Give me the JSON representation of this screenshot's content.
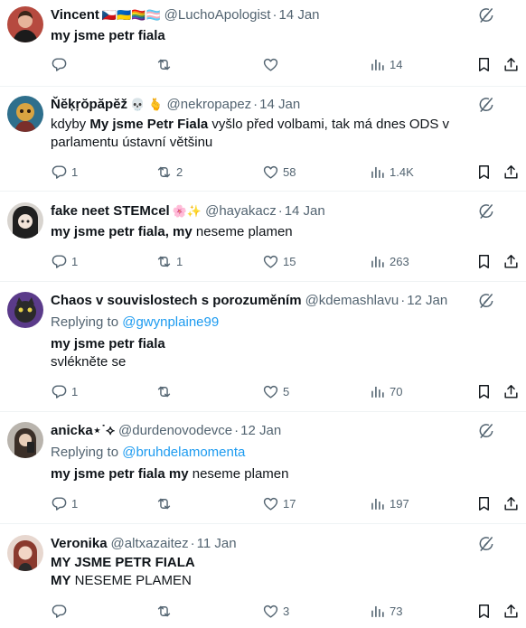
{
  "tweets": [
    {
      "name": "Vincent",
      "badges": "🇨🇿🇺🇦🏳️‍🌈🏳️‍⚧️",
      "handle": "@LuchoApologist",
      "date": "14 Jan",
      "reply_to": null,
      "text_bold": "my jsme petr fiala",
      "text_plain": "",
      "counts": {
        "replies": "",
        "retweets": "",
        "likes": "",
        "views": "14"
      },
      "avatar_color": "#7a3b35"
    },
    {
      "name": "Ňĕķŗŏpăpĕž",
      "badges": "💀 🫰",
      "handle": "@nekropapez",
      "date": "14 Jan",
      "reply_to": null,
      "text_prefix": "kdyby ",
      "text_bold": "My jsme Petr Fiala",
      "text_plain": " vyšlo před volbami, tak má dnes ODS v parlamentu ústavní většinu",
      "counts": {
        "replies": "1",
        "retweets": "2",
        "likes": "58",
        "views": "1.4K"
      },
      "avatar_color": "#2f6f8c"
    },
    {
      "name": "fake neet STEMcel",
      "badges": "🌸✨",
      "handle": "@hayakacz",
      "date": "14 Jan",
      "reply_to": null,
      "text_bold": "my jsme petr fiala, my",
      "text_plain": " neseme plamen",
      "counts": {
        "replies": "1",
        "retweets": "1",
        "likes": "15",
        "views": "263"
      },
      "avatar_color": "#3a3a3a"
    },
    {
      "name": "Chaos v souvislostech s porozuměním",
      "badges": "",
      "handle": "@kdemashlavu",
      "date": "12 Jan",
      "reply_to": {
        "label": "Replying to",
        "mention": "@gwynplaine99"
      },
      "text_bold": "my jsme petr fiala",
      "text_line2": "svlékněte se",
      "counts": {
        "replies": "1",
        "retweets": "",
        "likes": "5",
        "views": "70"
      },
      "avatar_color": "#5b3b8a"
    },
    {
      "name": "anicka⋆˙⟡",
      "badges": "",
      "handle": "@durdenovodevce",
      "date": "12 Jan",
      "reply_to": {
        "label": "Replying to",
        "mention": "@bruhdelamomenta"
      },
      "text_bold": "my jsme petr fiala my",
      "text_plain": " neseme plamen",
      "counts": {
        "replies": "1",
        "retweets": "",
        "likes": "17",
        "views": "197"
      },
      "avatar_color": "#6e6a66"
    },
    {
      "name": "Veronika",
      "badges": "",
      "handle": "@altxazaitez",
      "date": "11 Jan",
      "reply_to": null,
      "text_bold": "MY JSME PETR FIALA",
      "text_line2_bold": "MY",
      "text_line2_plain": " NESEME PLAMEN",
      "counts": {
        "replies": "",
        "retweets": "",
        "likes": "3",
        "views": "73"
      },
      "avatar_color": "#9c5b4a"
    }
  ],
  "separator": "·",
  "colors": {
    "text": "#0f1419",
    "muted": "#536471",
    "link": "#1d9bf0",
    "border": "#eff3f4"
  },
  "icons": [
    "reply-icon",
    "retweet-icon",
    "like-icon",
    "views-icon",
    "bookmark-icon",
    "share-icon",
    "grok-icon",
    "more-icon"
  ]
}
